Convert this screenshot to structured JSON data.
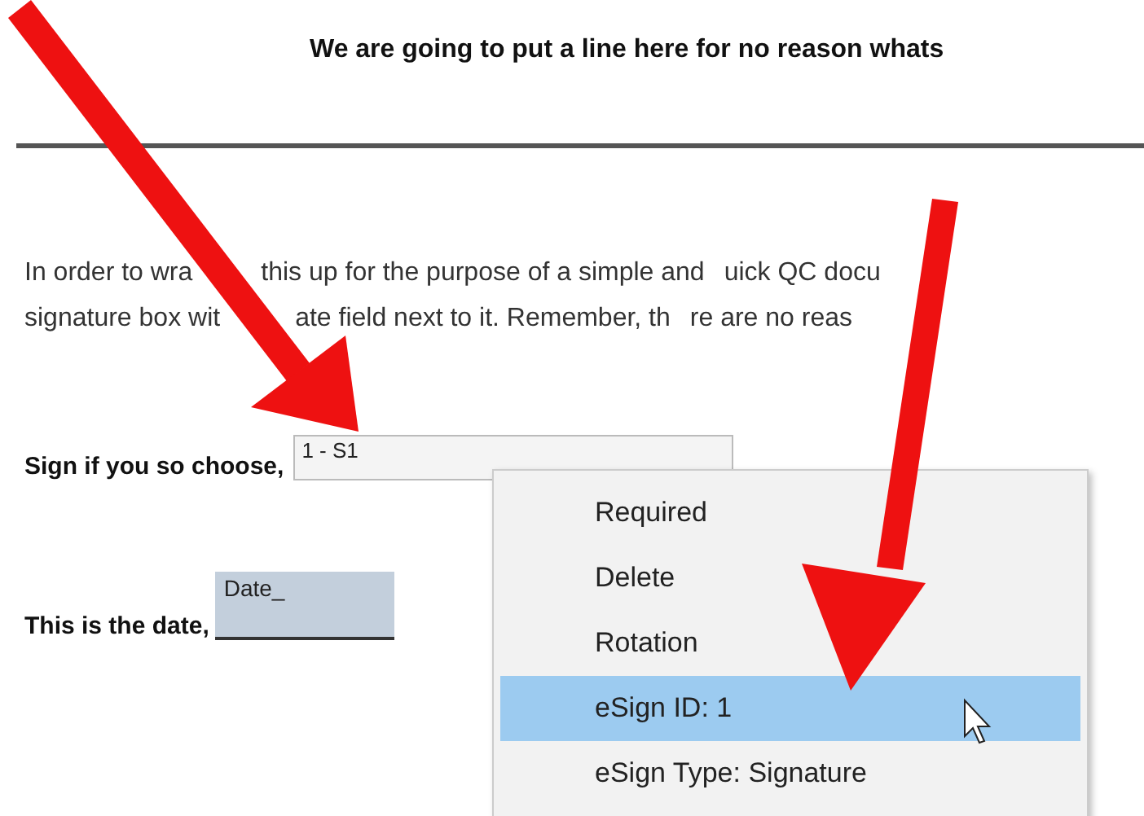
{
  "heading": "We are going to put a line here for no reason whats",
  "paragraph_lines": [
    [
      "In order to wra",
      "this up for the purpose of a simple and",
      "uick QC docu"
    ],
    [
      "signature box wit",
      "ate field next to it. Remember, th",
      "re are no reas"
    ]
  ],
  "signature": {
    "label": "Sign if you so choose,",
    "value": "1 - S1"
  },
  "date": {
    "label": "This is the date,",
    "value": "Date_"
  },
  "context_menu": [
    {
      "label": "Required",
      "selected": false
    },
    {
      "label": "Delete",
      "selected": false
    },
    {
      "label": "Rotation",
      "selected": false
    },
    {
      "label": "eSign ID: 1",
      "selected": true
    },
    {
      "label": "eSign Type: Signature",
      "selected": false
    }
  ]
}
